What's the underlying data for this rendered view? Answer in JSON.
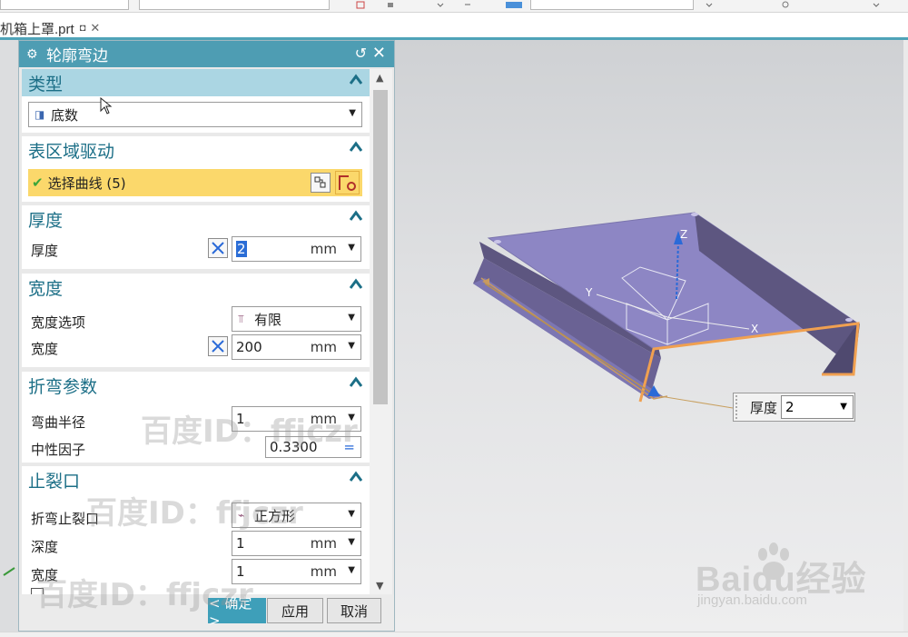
{
  "file_tab": {
    "name": "机箱上罩.prt",
    "pin_icon": "pin-icon",
    "close_icon": "close-icon"
  },
  "dialog": {
    "title": "轮廓弯边",
    "groups": {
      "type": {
        "header": "类型",
        "type_value": "底数"
      },
      "surface": {
        "header": "表区域驱动",
        "select_label": "选择曲线 (5)"
      },
      "thickness": {
        "header": "厚度",
        "label": "厚度",
        "value": "2",
        "unit": "mm"
      },
      "width": {
        "header": "宽度",
        "option_label": "宽度选项",
        "option_value": "有限",
        "width_label": "宽度",
        "width_value": "200",
        "unit": "mm"
      },
      "bend": {
        "header": "折弯参数",
        "radius_label": "弯曲半径",
        "radius_value": "1",
        "radius_unit": "mm",
        "neutral_label": "中性因子",
        "neutral_value": "0.3300",
        "neutral_eq": "="
      },
      "relief": {
        "header": "止裂口",
        "bend_relief_label": "折弯止裂口",
        "bend_relief_value": "正方形",
        "depth_label": "深度",
        "depth_value": "1",
        "depth_unit": "mm",
        "width_label": "宽度",
        "width_value": "1",
        "width_unit": "mm"
      }
    },
    "buttons": {
      "ok": "< 确定 >",
      "apply": "应用",
      "cancel": "取消"
    }
  },
  "viewport": {
    "floating_label": "厚度",
    "floating_value": "2",
    "axis_x": "X",
    "axis_y": "Y",
    "axis_z": "Z"
  },
  "watermarks": [
    "百度ID：ffjczr",
    "百度ID：ffjczr",
    "百度ID：ffjczr"
  ],
  "logo": {
    "brand": "Baidu经验",
    "url": "jingyan.baidu.com"
  },
  "colors": {
    "title_bar": "#4e9db3",
    "header_text": "#1c6f87",
    "selection": "#fbd86b",
    "active_header": "#abd6e3",
    "part_face": "#8f87c9",
    "part_edge": "#f0a050"
  }
}
